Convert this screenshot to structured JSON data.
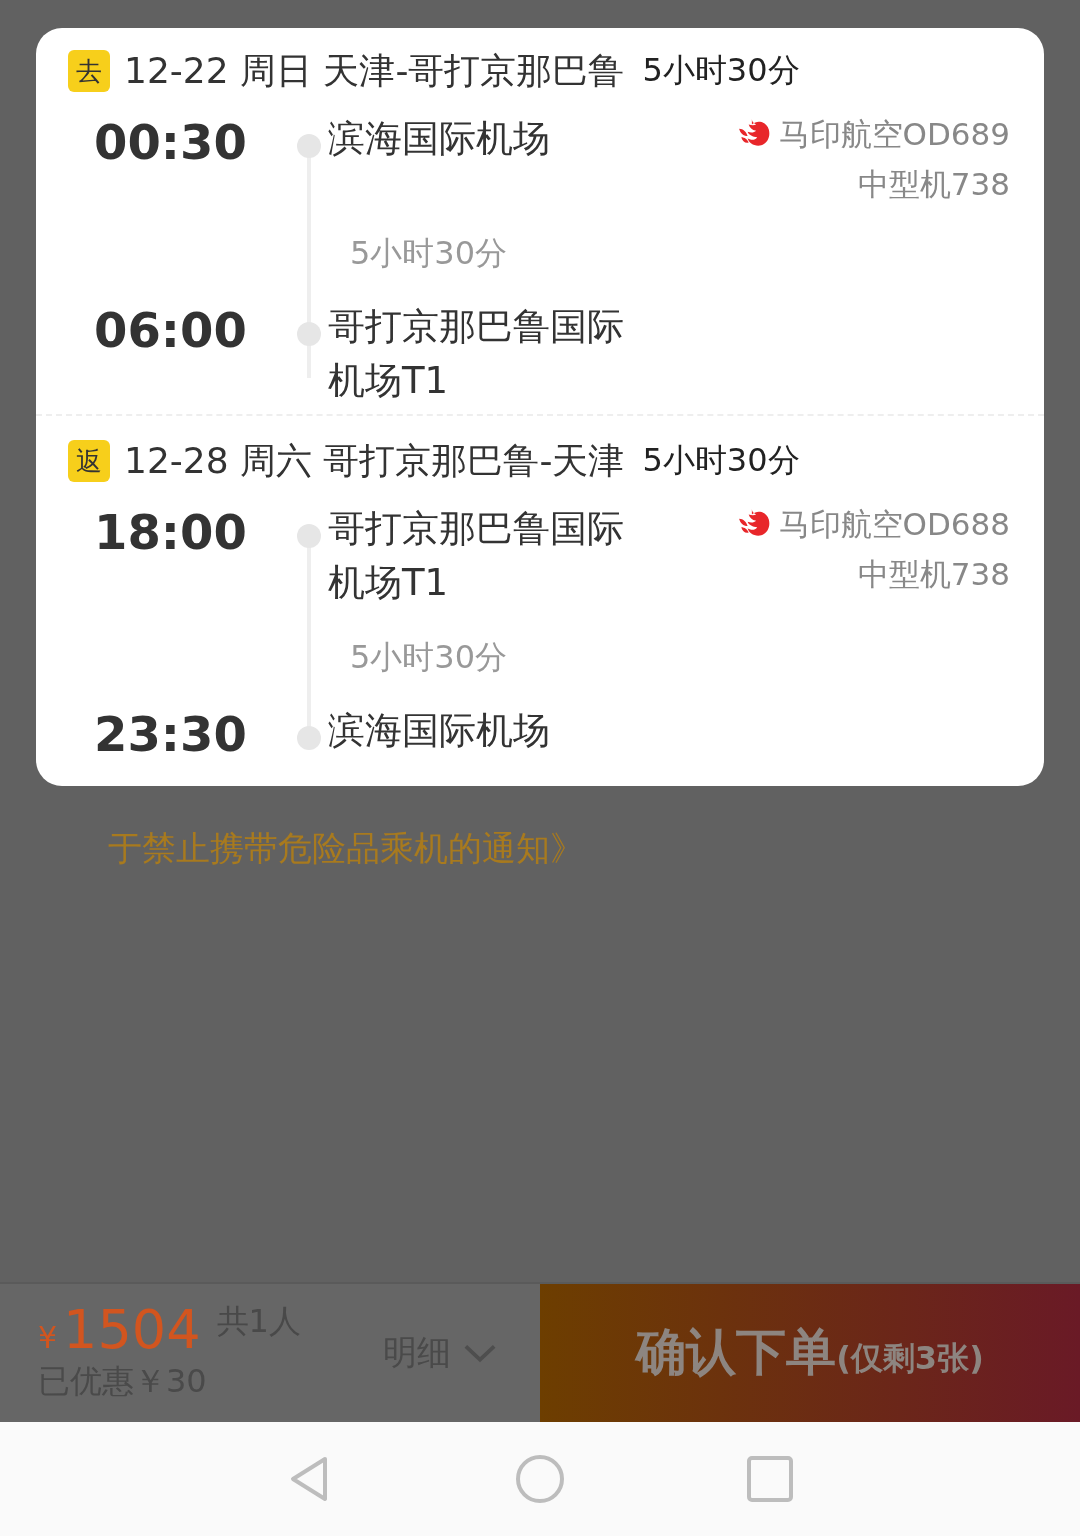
{
  "itinerary": [
    {
      "badge": "去",
      "date_route": "12-22 周日 天津-哥打京那巴鲁",
      "duration": "5小时30分",
      "departure": {
        "time": "00:30",
        "airport": "滨海国际机场"
      },
      "flight_time": "5小时30分",
      "arrival": {
        "time": "06:00",
        "airport": "哥打京那巴鲁国际机场T1"
      },
      "airline": "马印航空OD689",
      "aircraft": "中型机738"
    },
    {
      "badge": "返",
      "date_route": "12-28 周六 哥打京那巴鲁-天津",
      "duration": "5小时30分",
      "departure": {
        "time": "18:00",
        "airport": "哥打京那巴鲁国际机场T1"
      },
      "flight_time": "5小时30分",
      "arrival": {
        "time": "23:30",
        "airport": "滨海国际机场"
      },
      "airline": "马印航空OD688",
      "aircraft": "中型机738"
    }
  ],
  "notice": "于禁止携带危险品乘机的通知》",
  "bottom_bar": {
    "currency": "¥",
    "price": "1504",
    "passengers": "共1人",
    "discount": "已优惠￥30",
    "details": "明细",
    "confirm": "确认下单",
    "remaining": "(仅剩3张)"
  }
}
